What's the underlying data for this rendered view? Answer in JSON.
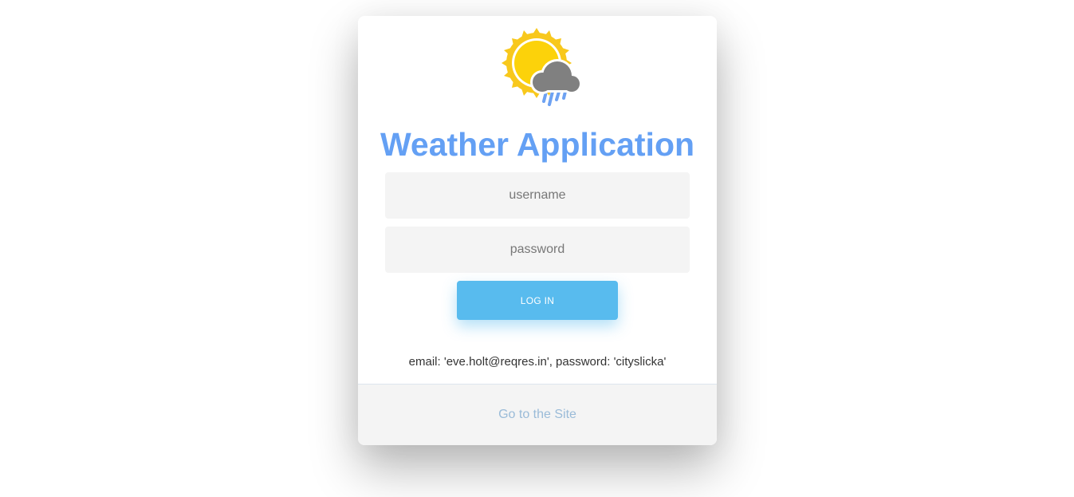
{
  "app": {
    "title": "Weather Application",
    "logo_icon": "sun-cloud-rain-icon",
    "accent_color": "#64a0f4"
  },
  "form": {
    "username_placeholder": "username",
    "username_value": "",
    "password_placeholder": "password",
    "password_value": "",
    "login_label": "LOG IN",
    "login_color": "#58bbee"
  },
  "hint": {
    "text": "email: 'eve.holt@reqres.in', password: 'cityslicka'"
  },
  "footer": {
    "link_label": "Go to the Site",
    "link_color": "#9abbd8"
  }
}
